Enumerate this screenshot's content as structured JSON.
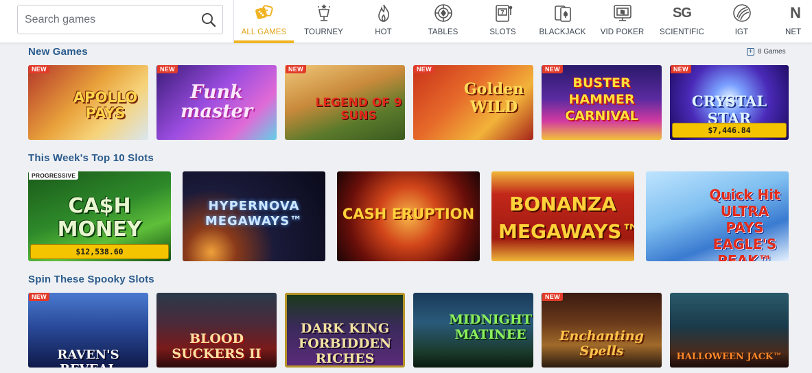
{
  "search": {
    "placeholder": "Search games"
  },
  "nav": [
    {
      "label": "ALL GAMES",
      "icon": "dice-icon",
      "active": true
    },
    {
      "label": "TOURNEY",
      "icon": "trophy-stars-icon"
    },
    {
      "label": "HOT",
      "icon": "flame-icon"
    },
    {
      "label": "TABLES",
      "icon": "poker-chip-icon"
    },
    {
      "label": "SLOTS",
      "icon": "slot-machine-icon"
    },
    {
      "label": "BLACKJACK",
      "icon": "playing-cards-icon"
    },
    {
      "label": "VID POKER",
      "icon": "video-poker-icon"
    },
    {
      "label": "SCIENTIFIC",
      "icon": "sg-logo-icon",
      "icon_text": "SG"
    },
    {
      "label": "IGT",
      "icon": "igt-logo-icon"
    },
    {
      "label": "NET",
      "icon": "netent-logo-icon",
      "icon_text": "N"
    }
  ],
  "sections": {
    "new_games": {
      "title": "New Games",
      "count_label": "8 Games",
      "games": [
        {
          "name": "Apollo Pays",
          "art_text": "APOLLO PAYS",
          "badge": "NEW"
        },
        {
          "name": "Funk Master",
          "art_text": "Funk master",
          "badge": "NEW"
        },
        {
          "name": "Legend of 9 Suns",
          "art_text": "LEGEND OF 9 SUNS",
          "badge": "NEW"
        },
        {
          "name": "Golden Wild",
          "art_text": "Golden WILD",
          "badge": "NEW"
        },
        {
          "name": "Buster Hammer Carnival",
          "art_text": "BUSTER HAMMER CARNIVAL",
          "badge": "NEW"
        },
        {
          "name": "Crystal Star",
          "art_text": "CRYSTAL STAR",
          "badge": "NEW",
          "jackpot": "$7,446.84"
        }
      ]
    },
    "top10": {
      "title": "This Week's Top 10 Slots",
      "games": [
        {
          "name": "Cash Money",
          "art_text": "CA$H MONEY",
          "badge": "PROGRESSIVE",
          "jackpot": "$12,538.60"
        },
        {
          "name": "Hypernova Megaways",
          "art_text": "HYPERNOVA MEGAWAYS™"
        },
        {
          "name": "Cash Eruption",
          "art_text": "CASH ERUPTION"
        },
        {
          "name": "Bonanza Megaways",
          "art_text": "BONANZA MEGAWAYS™"
        },
        {
          "name": "Quick Hit Ultra Pays Eagle's Peak",
          "art_text": "Quick Hit ULTRA PAYS EAGLE'S PEAK™"
        }
      ]
    },
    "spooky": {
      "title": "Spin These Spooky Slots",
      "games": [
        {
          "name": "Raven's Reveal",
          "art_text": "RAVEN'S REVEAL",
          "badge": "NEW"
        },
        {
          "name": "Blood Suckers II",
          "art_text": "BLOOD SUCKERS II"
        },
        {
          "name": "Dark King Forbidden Riches",
          "art_text": "DARK KING FORBIDDEN RICHES"
        },
        {
          "name": "Midnight Matinee",
          "art_text": "MIDNIGHT MATINEE"
        },
        {
          "name": "Enchanting Spells",
          "art_text": "Enchanting Spells",
          "badge": "NEW"
        },
        {
          "name": "Halloween Jack",
          "art_text": "HALLOWEEN JACK™"
        }
      ]
    }
  },
  "colors": {
    "accent": "#f0b323",
    "section_title": "#2a5a8c",
    "badge_new": "#e23b2a",
    "jackpot_bg": "#f5c400",
    "page_bg": "#eef0f3"
  }
}
